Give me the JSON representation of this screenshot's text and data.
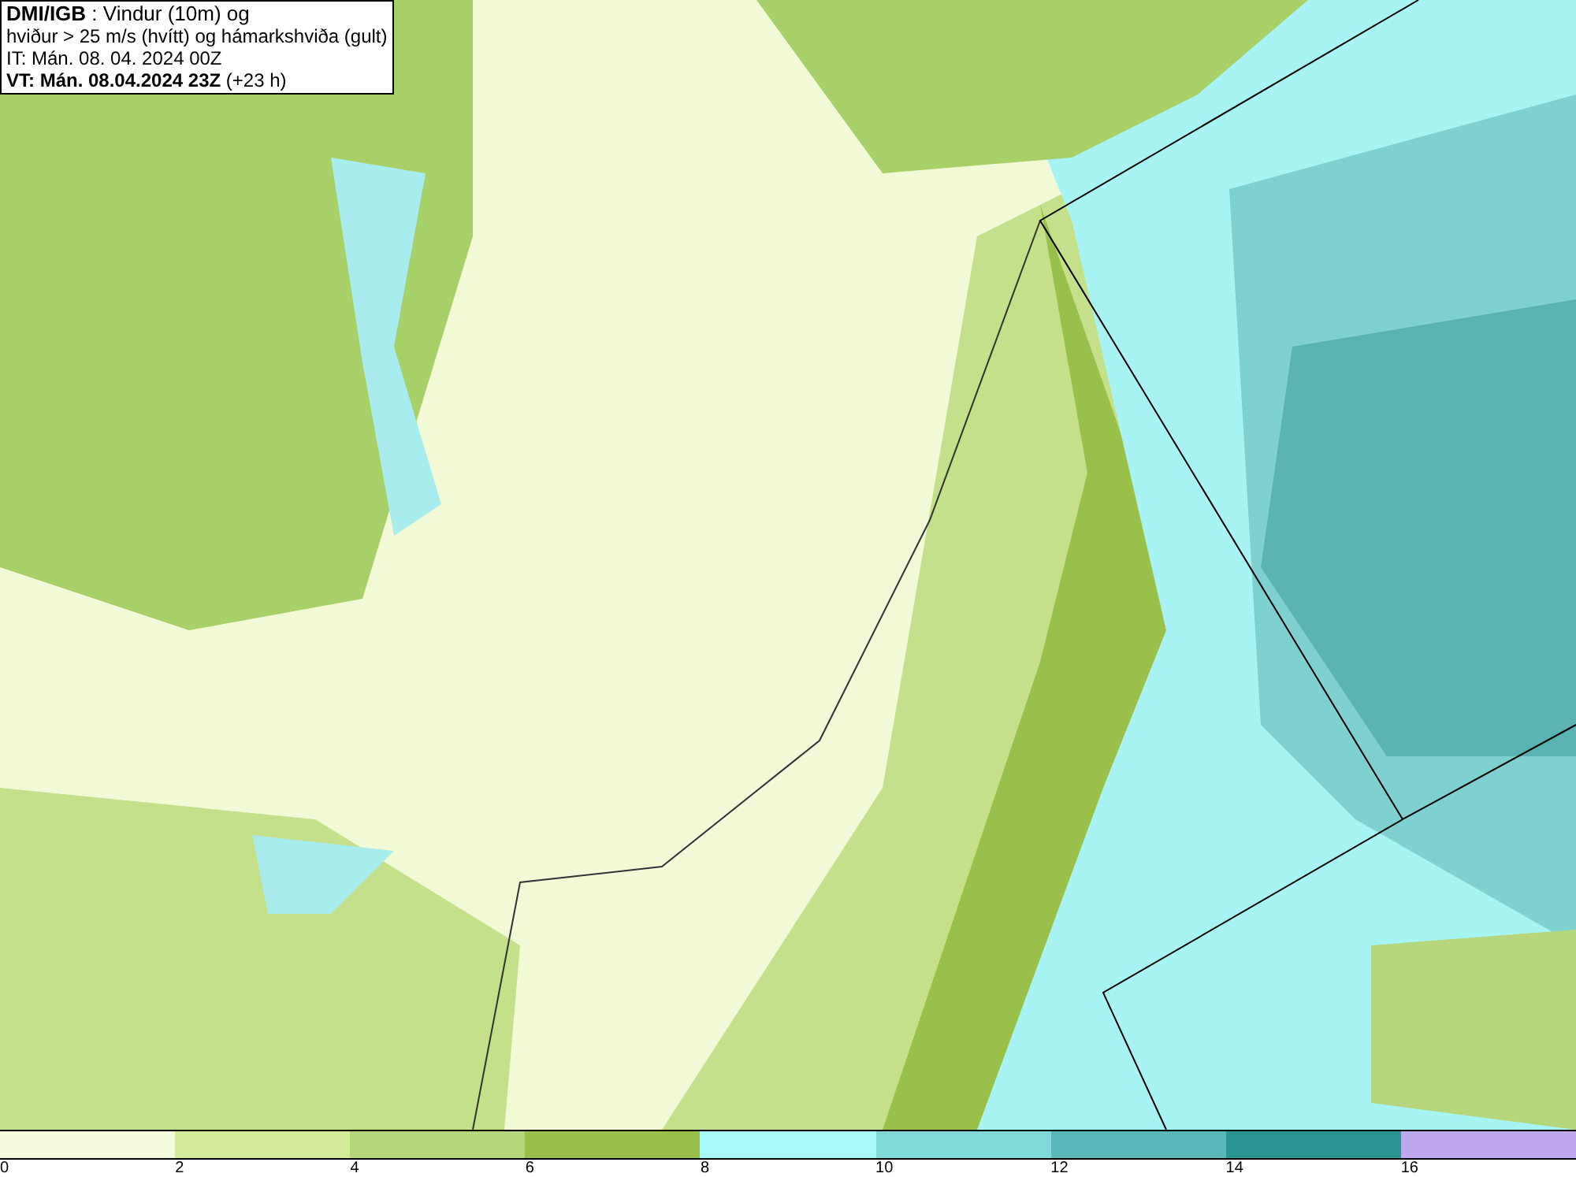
{
  "title_box": {
    "lines": [
      "**DMI/IGB** : Vindur (10m) og",
      "hviður > 25 m/s (hvítt) og hámarkshviða (gult)",
      "IT: Mán. 08. 04. 2024 00Z",
      "**VT: Mán. 08.04.2024 23Z** (+23 h)"
    ]
  },
  "legend": {
    "bins": [
      {
        "color": "#f4fadc"
      },
      {
        "color": "#d4eb9c"
      },
      {
        "color": "#b5d67a"
      },
      {
        "color": "#99c04a"
      },
      {
        "color": "#a8fafa"
      },
      {
        "color": "#80d8d8"
      },
      {
        "color": "#5ab8b8"
      },
      {
        "color": "#2a9490"
      },
      {
        "color": "#c0a8ee"
      }
    ],
    "ticks": [
      "0",
      "2",
      "4",
      "6",
      "8",
      "10",
      "12",
      "14",
      "16"
    ]
  }
}
